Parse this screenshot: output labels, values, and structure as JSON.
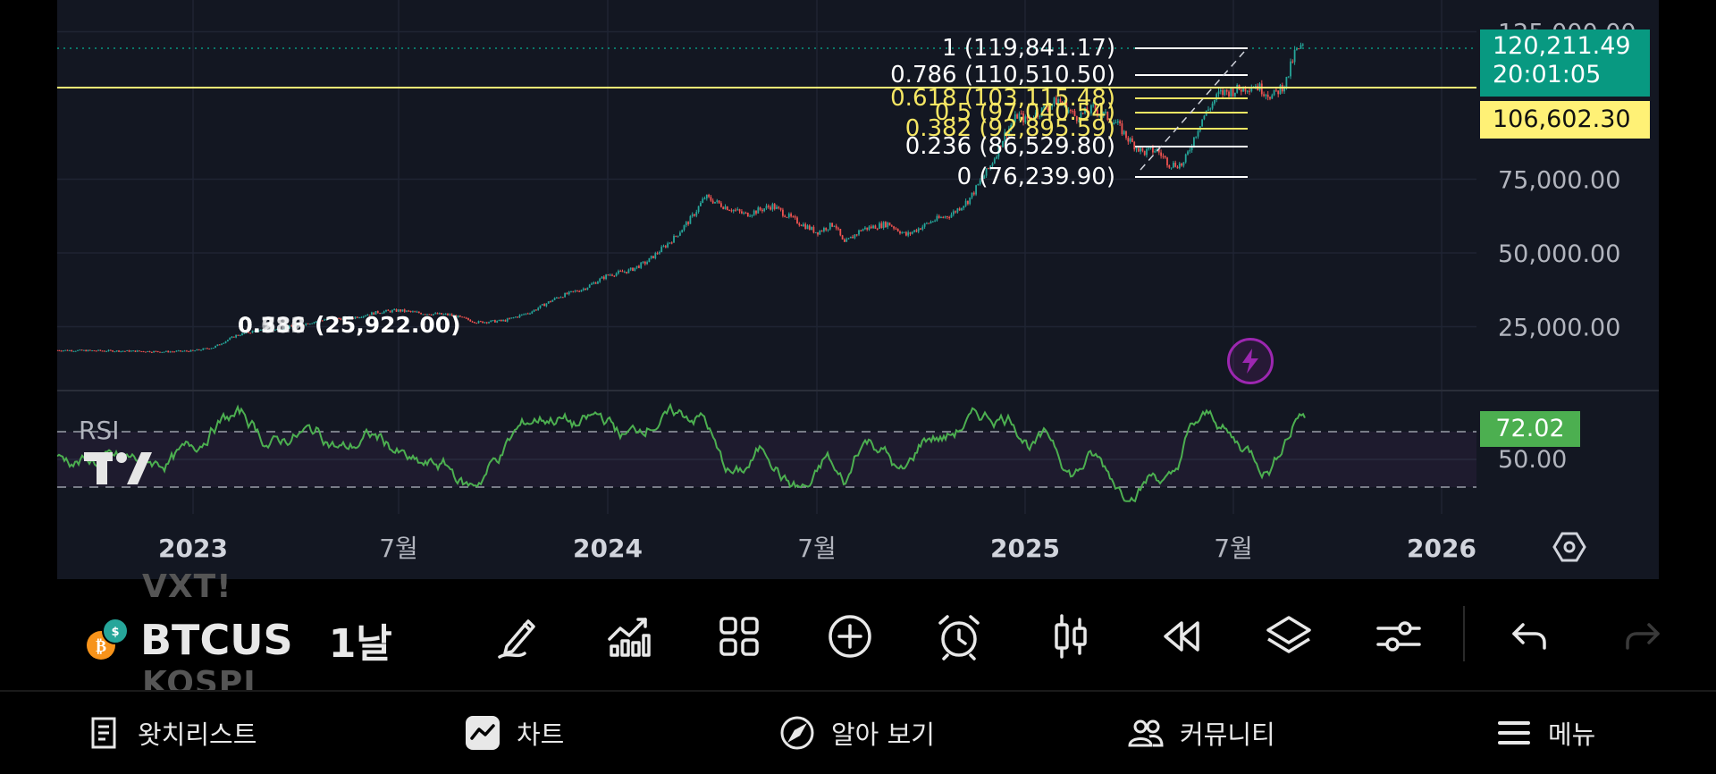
{
  "chart": {
    "price_levels": [
      {
        "value": 25000,
        "label": "25,000.00"
      },
      {
        "value": 50000,
        "label": "50,000.00"
      },
      {
        "value": 75000,
        "label": "75,000.00"
      },
      {
        "value": 125000,
        "label": "125,000.00"
      }
    ],
    "current_price": "120,211.49",
    "countdown": "20:01:05",
    "horizontal_line_price": "106,602.30",
    "fib_levels": [
      {
        "label": "1 (119,841.17)",
        "value": 119841.17,
        "color": "#ffffff"
      },
      {
        "label": "0.786 (110,510.50)",
        "value": 110510.5,
        "color": "#ffffff"
      },
      {
        "label": "0.618 (103,115.48)",
        "value": 103115.48,
        "color": "#f5e663"
      },
      {
        "label": "0.5 (97,040.54)",
        "value": 97040.54,
        "color": "#f5e663"
      },
      {
        "label": "0.382 (92,895.59)",
        "value": 92895.59,
        "color": "#f5e663"
      },
      {
        "label": "0.236 (86,529.80)",
        "value": 86529.8,
        "color": "#ffffff"
      },
      {
        "label": "0 (76,239.90)",
        "value": 76239.9,
        "color": "#ffffff"
      }
    ],
    "old_fib_label": "(25,922.00)",
    "old_fib_overlap": [
      "0.236",
      "0.382",
      "0.5",
      "0.618",
      "0.786"
    ],
    "x_axis": [
      {
        "label": "2023",
        "bold": true
      },
      {
        "label": "7월",
        "bold": false
      },
      {
        "label": "2024",
        "bold": true
      },
      {
        "label": "7월",
        "bold": false
      },
      {
        "label": "2025",
        "bold": true
      },
      {
        "label": "7월",
        "bold": false
      },
      {
        "label": "2026",
        "bold": true
      }
    ]
  },
  "rsi": {
    "label": "RSI",
    "value": "72.02",
    "level_label": "50.00"
  },
  "colors": {
    "background": "#131722",
    "grid": "#1f2433",
    "up": "#26a69a",
    "down": "#ef5350",
    "rsi_line": "#4caf50",
    "price_tag": "#089981",
    "hline": "#fff176",
    "alert_icon": "#9c27b0"
  },
  "symbol": {
    "name": "BTCUS",
    "interval": "1날",
    "ghost_above": "VXT!",
    "ghost_below": "KOSPI"
  },
  "tools": [
    {
      "name": "drawing-icon"
    },
    {
      "name": "indicators-icon"
    },
    {
      "name": "templates-icon"
    },
    {
      "name": "add-icon"
    },
    {
      "name": "alert-icon"
    },
    {
      "name": "chart-type-icon"
    },
    {
      "name": "replay-icon"
    },
    {
      "name": "layers-icon"
    },
    {
      "name": "settings-sliders-icon"
    },
    {
      "name": "undo-icon"
    },
    {
      "name": "redo-icon"
    }
  ],
  "nav": [
    {
      "label": "왓치리스트",
      "icon": "watchlist-icon"
    },
    {
      "label": "차트",
      "icon": "chart-icon"
    },
    {
      "label": "알아 보기",
      "icon": "compass-icon"
    },
    {
      "label": "커뮤니티",
      "icon": "community-icon"
    },
    {
      "label": "메뉴",
      "icon": "menu-icon"
    }
  ]
}
